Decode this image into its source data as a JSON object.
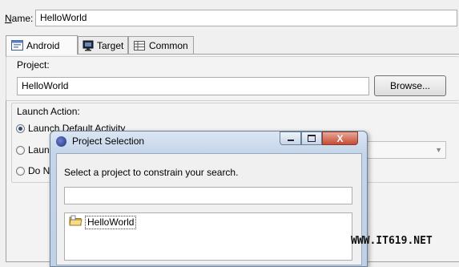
{
  "name_row": {
    "label_prefix": "N",
    "label_rest": "ame:",
    "value": "HelloWorld"
  },
  "tabs": [
    {
      "label": "Android",
      "icon": "android-config-icon",
      "active": true
    },
    {
      "label": "Target",
      "icon": "target-monitor-icon",
      "active": false
    },
    {
      "label": "Common",
      "icon": "common-table-icon",
      "active": false
    }
  ],
  "project": {
    "label": "Project:",
    "value": "HelloWorld",
    "browse_label": "Browse..."
  },
  "launch_action": {
    "label": "Launch Action:",
    "options": [
      {
        "label": "Launch Default Activity",
        "checked": true
      },
      {
        "label": "Laun",
        "checked": false
      },
      {
        "label": "Do N",
        "checked": false
      }
    ]
  },
  "dialog": {
    "title": "Project Selection",
    "prompt": "Select a project to constrain your search.",
    "filter_value": "",
    "items": [
      {
        "label": "HelloWorld",
        "icon": "project-folder-icon"
      }
    ],
    "close_glyph": "X"
  },
  "watermark": "WWW.IT619.NET",
  "colors": {
    "dialog_frame": "#bfd1e6",
    "close_button": "#c74b33",
    "radio_dot": "#2a4a7a"
  }
}
